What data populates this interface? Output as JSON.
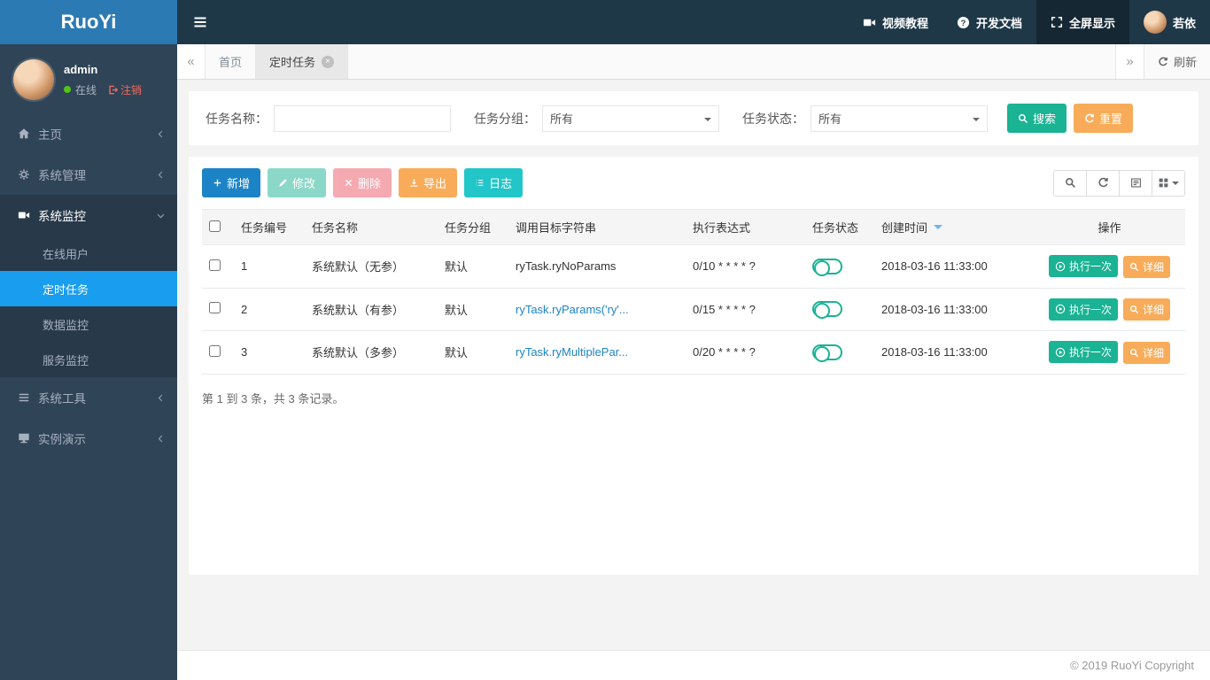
{
  "brand": {
    "logo": "RuoYi",
    "copyright": "© 2019 RuoYi Copyright"
  },
  "colors": {
    "primary_green": "#1ab394",
    "info_cyan": "#23c6c8",
    "warning_orange": "#f8ac59",
    "danger_red": "#ed5565",
    "link_blue": "#1c84c6",
    "active_menu_blue": "#199dee",
    "topbar_navy": "#1f3848",
    "sidebar_slate": "#2f4456",
    "logo_blue": "#2b7ab3"
  },
  "icons": {
    "menu": "hamburger-bars",
    "video": "video-camera",
    "docs": "question-circle",
    "fullscreen": "expand-arrows",
    "search": "magnifier",
    "refresh": "circular-arrow",
    "sort": "caret-down",
    "toggle": "switch-pill",
    "run": "play-circle"
  },
  "topbar": {
    "video_tutorial": "视频教程",
    "dev_docs": "开发文档",
    "fullscreen": "全屏显示",
    "username": "若依"
  },
  "sidebar": {
    "user": {
      "name": "admin",
      "status": "在线",
      "logout": "注销"
    },
    "items": [
      {
        "label": "主页"
      },
      {
        "label": "系统管理"
      },
      {
        "label": "系统监控"
      },
      {
        "label": "系统工具"
      },
      {
        "label": "实例演示"
      }
    ],
    "submenu": [
      {
        "label": "在线用户"
      },
      {
        "label": "定时任务"
      },
      {
        "label": "数据监控"
      },
      {
        "label": "服务监控"
      }
    ]
  },
  "tabs": {
    "home": "首页",
    "active": "定时任务",
    "refresh": "刷新"
  },
  "search": {
    "task_name_label": "任务名称：",
    "task_name_value": "",
    "task_group_label": "任务分组：",
    "group_value": "所有",
    "task_status_label": "任务状态：",
    "status_value": "所有",
    "search_btn": "搜索",
    "reset_btn": "重置"
  },
  "toolbar": {
    "add": "新增",
    "edit": "修改",
    "delete": "删除",
    "export": "导出",
    "log": "日志"
  },
  "table": {
    "headers": [
      "任务编号",
      "任务名称",
      "任务分组",
      "调用目标字符串",
      "执行表达式",
      "任务状态",
      "创建时间",
      "操作"
    ],
    "rows": [
      {
        "id": "1",
        "name": "系统默认（无参）",
        "group": "默认",
        "target": "ryTask.ryNoParams",
        "cron": "0/10 * * * * ?",
        "time": "2018-03-16 11:33:00"
      },
      {
        "id": "2",
        "name": "系统默认（有参）",
        "group": "默认",
        "target": "ryTask.ryParams('ry'...",
        "cron": "0/15 * * * * ?",
        "time": "2018-03-16 11:33:00"
      },
      {
        "id": "3",
        "name": "系统默认（多参）",
        "group": "默认",
        "target": "ryTask.ryMultiplePar...",
        "cron": "0/20 * * * * ?",
        "time": "2018-03-16 11:33:00"
      }
    ],
    "row_actions": {
      "run": "执行一次",
      "detail": "详细"
    },
    "summary": "第 1 到 3 条，共 3 条记录。"
  }
}
